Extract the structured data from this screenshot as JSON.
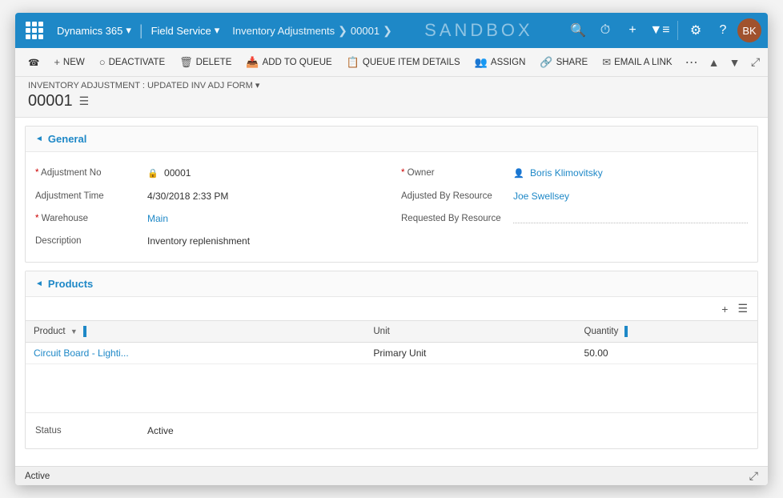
{
  "app": {
    "brand": "Dynamics 365",
    "module": "Field Service",
    "breadcrumb_module": "Inventory Adjustments",
    "breadcrumb_record": "00001",
    "sandbox_label": "SANDBOX"
  },
  "toolbar": {
    "new_label": "NEW",
    "deactivate_label": "DEACTIVATE",
    "delete_label": "DELETE",
    "add_to_queue_label": "ADD TO QUEUE",
    "queue_item_details_label": "QUEUE ITEM DETAILS",
    "assign_label": "ASSIGN",
    "share_label": "SHARE",
    "email_a_link_label": "EMAIL A LINK"
  },
  "record": {
    "breadcrumb": "INVENTORY ADJUSTMENT : UPDATED INV ADJ FORM",
    "id": "00001"
  },
  "general": {
    "section_title": "General",
    "fields": {
      "adjustment_no_label": "Adjustment No",
      "adjustment_no_value": "00001",
      "adjustment_time_label": "Adjustment Time",
      "adjustment_time_value": "4/30/2018  2:33 PM",
      "warehouse_label": "Warehouse",
      "warehouse_value": "Main",
      "description_label": "Description",
      "description_value": "Inventory replenishment",
      "owner_label": "Owner",
      "owner_value": "Boris Klimovitsky",
      "adjusted_by_resource_label": "Adjusted By Resource",
      "adjusted_by_resource_value": "Joe Swellsey",
      "requested_by_resource_label": "Requested By Resource",
      "requested_by_resource_value": ""
    }
  },
  "products": {
    "section_title": "Products",
    "columns": {
      "product": "Product",
      "unit": "Unit",
      "quantity": "Quantity"
    },
    "rows": [
      {
        "product": "Circuit Board - Lighti...",
        "unit": "Primary Unit",
        "quantity": "50.00"
      }
    ]
  },
  "status": {
    "label": "Status",
    "value": "Active"
  },
  "bottom_bar": {
    "status": "Active"
  }
}
